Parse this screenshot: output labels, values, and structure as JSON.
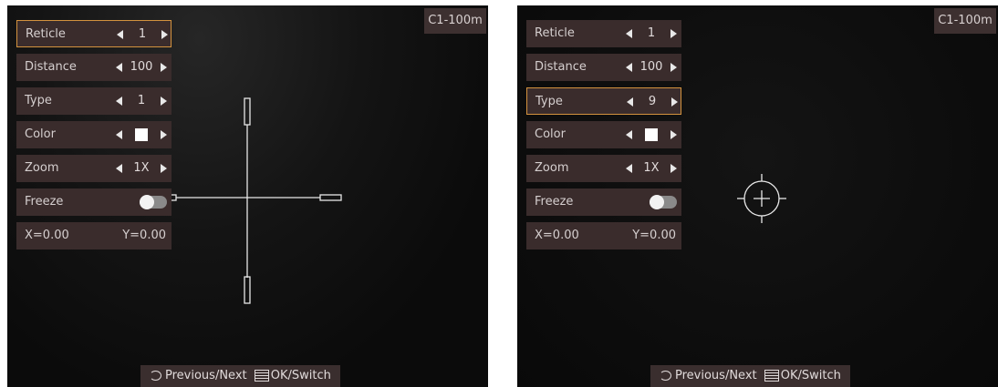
{
  "left": {
    "badge": "C1-100m",
    "menu": {
      "reticle": {
        "label": "Reticle",
        "value": "1"
      },
      "distance": {
        "label": "Distance",
        "value": "100"
      },
      "type": {
        "label": "Type",
        "value": "1"
      },
      "color": {
        "label": "Color",
        "value_color": "#ffffff"
      },
      "zoom": {
        "label": "Zoom",
        "value": "1X"
      },
      "freeze": {
        "label": "Freeze",
        "state": "off"
      },
      "coords": {
        "x": "X=0.00",
        "y": "Y=0.00"
      }
    },
    "footer": {
      "prev_next": "Previous/Next",
      "ok_switch": "OK/Switch"
    }
  },
  "right": {
    "badge": "C1-100m",
    "menu": {
      "reticle": {
        "label": "Reticle",
        "value": "1"
      },
      "distance": {
        "label": "Distance",
        "value": "100"
      },
      "type": {
        "label": "Type",
        "value": "9"
      },
      "color": {
        "label": "Color",
        "value_color": "#ffffff"
      },
      "zoom": {
        "label": "Zoom",
        "value": "1X"
      },
      "freeze": {
        "label": "Freeze",
        "state": "off"
      },
      "coords": {
        "x": "X=0.00",
        "y": "Y=0.00"
      }
    },
    "footer": {
      "prev_next": "Previous/Next",
      "ok_switch": "OK/Switch"
    }
  },
  "colors": {
    "selected_border": "#d3923e",
    "menu_bg": "#3a2c2c"
  }
}
